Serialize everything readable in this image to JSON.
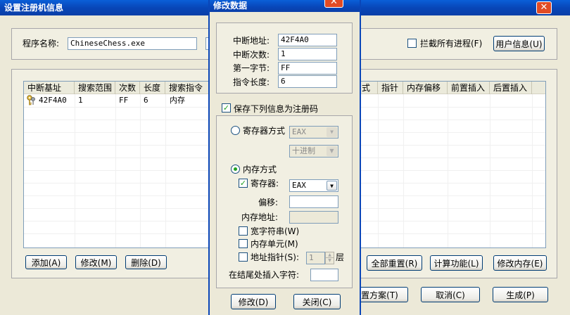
{
  "main": {
    "title": "设置注册机信息",
    "program_label": "程序名称:",
    "program_value": "ChineseChess.exe",
    "intercept_label": "拦截所有进程(F)",
    "user_info_btn": "用户信息(U)",
    "list": {
      "headers_left": [
        "中断基址",
        "搜索范围",
        "次数",
        "长度",
        "搜索指令"
      ],
      "headers_right": [
        "式",
        "指针",
        "内存偏移",
        "前置插入",
        "后置插入"
      ],
      "rows": [
        {
          "icon": "keys-icon",
          "addr": "42F4A0",
          "range": "1",
          "count": "FF",
          "length": "6",
          "instr": "内存"
        }
      ]
    },
    "buttons": {
      "add": "添加(A)",
      "modify": "修改(M)",
      "delete": "删除(D)",
      "reset_all": "全部重置(R)",
      "calc": "计算功能(L)",
      "modify_mem": "修改内存(E)",
      "scheme": "置方案(T)",
      "cancel": "取消(C)",
      "generate": "生成(P)"
    }
  },
  "dialog": {
    "title": "修改数据",
    "fields": {
      "bp_addr_label": "中断地址:",
      "bp_addr_value": "42F4A0",
      "bp_count_label": "中断次数:",
      "bp_count_value": "1",
      "first_byte_label": "第一字节:",
      "first_byte_value": "FF",
      "instr_len_label": "指令长度:",
      "instr_len_value": "6"
    },
    "save_as_reg_label": "保存下列信息为注册码",
    "register_mode_label": "寄存器方式",
    "register_combo": "EAX",
    "radix_combo": "十进制",
    "memory_mode_label": "内存方式",
    "register_label": "寄存器:",
    "register_value": "EAX",
    "offset_label": "偏移:",
    "mem_addr_label": "内存地址:",
    "wide_string_label": "宽字符串(W)",
    "mem_unit_label": "内存单元(M)",
    "addr_pointer_label": "地址指针(S):",
    "pointer_level_value": "1",
    "layer_label": "层",
    "insert_end_label": "在结尾处插入字符:",
    "modify_btn": "修改(D)",
    "close_btn": "关闭(C)"
  }
}
